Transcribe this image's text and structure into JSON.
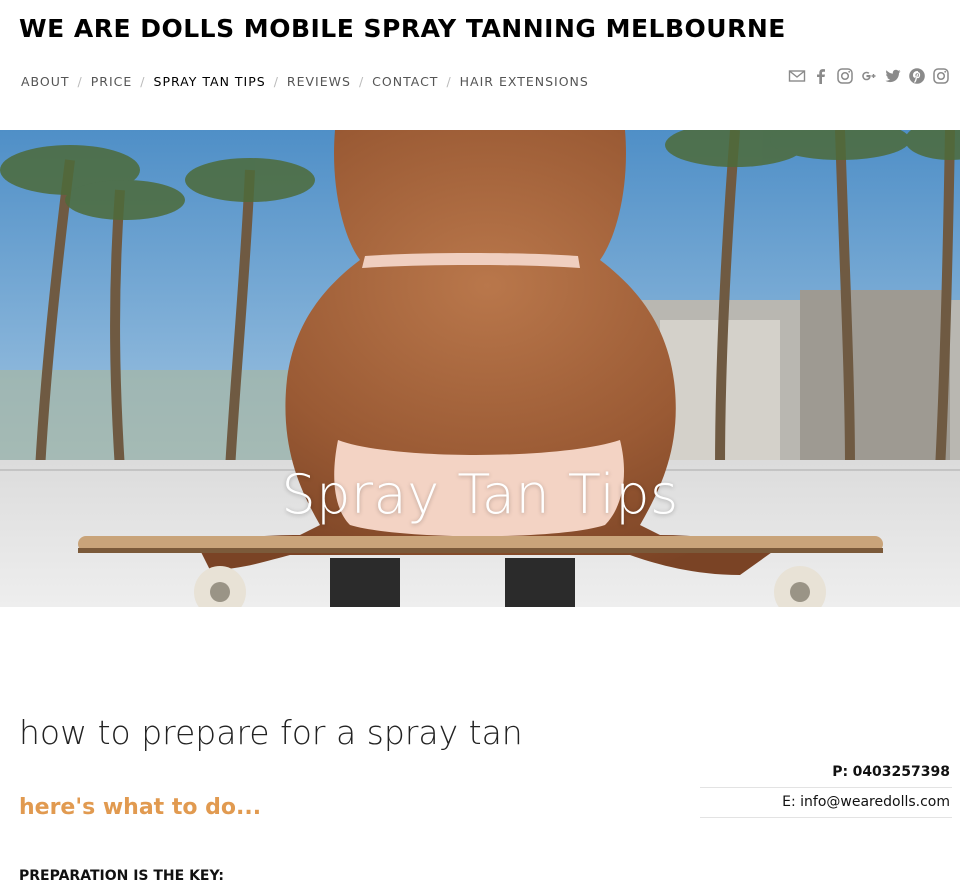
{
  "site": {
    "title": "WE ARE DOLLS MOBILE SPRAY TANNING MELBOURNE"
  },
  "nav": {
    "items": [
      {
        "label": "ABOUT"
      },
      {
        "label": "PRICE"
      },
      {
        "label": "SPRAY TAN TIPS",
        "active": true
      },
      {
        "label": "REVIEWS"
      },
      {
        "label": "CONTACT"
      },
      {
        "label": "HAIR EXTENSIONS"
      }
    ],
    "separator": "/"
  },
  "social": {
    "icons": [
      "email-icon",
      "facebook-icon",
      "instagram-icon",
      "google-plus-icon",
      "twitter-icon",
      "pinterest-icon",
      "instagram-icon"
    ],
    "color": "#8a8a8a"
  },
  "hero": {
    "title": "Spray Tan Tips"
  },
  "content": {
    "heading": "how to prepare for a spray tan",
    "subheading": "here's what to do...",
    "prep_label": "PREPARATION IS THE KEY:"
  },
  "contact": {
    "phone_label": "P:",
    "phone": "0403257398",
    "email_label": "E:",
    "email": "info@wearedolls.com"
  },
  "colors": {
    "accent": "#e19a50",
    "text": "#111111",
    "nav_active": "#000000",
    "nav": "#555555"
  }
}
